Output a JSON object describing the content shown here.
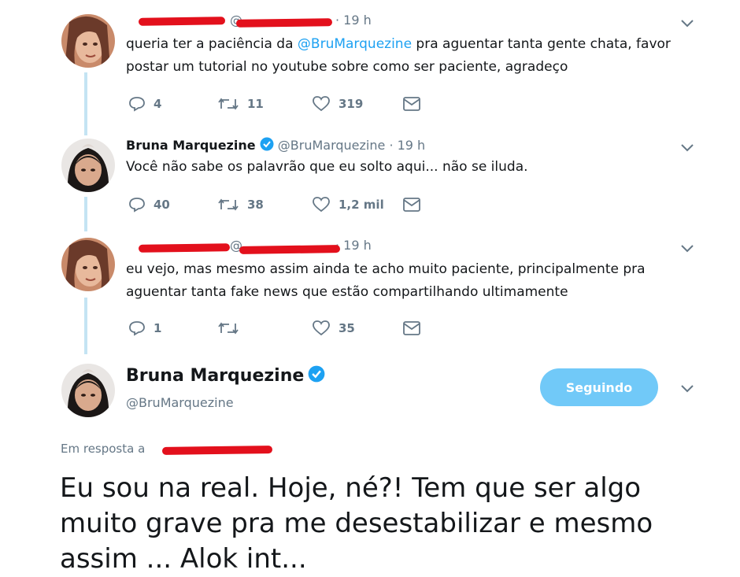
{
  "tweets": [
    {
      "author_name": "",
      "handle": "@",
      "time": "· 19 h",
      "text_before": "queria ter a paciência da ",
      "mention": "@BruMarquezine",
      "text_after": " pra aguentar tanta gente chata, favor postar um tutorial no youtube sobre como ser paciente, agradeço",
      "replies": "4",
      "retweets": "11",
      "likes": "319"
    },
    {
      "author_name": "Bruna Marquezine",
      "handle": "@BruMarquezine",
      "time": "· 19 h",
      "text": "Você não sabe os palavrão que eu solto aqui... não se iluda.",
      "replies": "40",
      "retweets": "38",
      "likes": "1,2 mil"
    },
    {
      "author_name": "",
      "handle": "@",
      "time": "· 19 h",
      "text": "eu vejo, mas mesmo assim ainda te acho muito paciente, principalmente pra aguentar tanta fake news que estão compartilhando ultimamente",
      "replies": "1",
      "retweets": "",
      "likes": "35"
    }
  ],
  "main_tweet": {
    "author_name": "Bruna Marquezine",
    "handle": "@BruMarquezine",
    "follow_label": "Seguindo",
    "reply_to_label": "Em resposta a",
    "text": "Eu sou na real. Hoje, né?! Tem que ser algo muito grave pra me desestabilizar e mesmo assim ... Alok int..."
  },
  "colors": {
    "accent": "#1da1f2",
    "follow_button": "#71c9f8",
    "thread_line": "#c4e4f3",
    "redaction": "#e3101c",
    "muted": "#657786"
  },
  "icons": [
    "reply-icon",
    "retweet-icon",
    "like-icon",
    "direct-message-icon",
    "chevron-down-icon",
    "verified-badge-icon"
  ]
}
